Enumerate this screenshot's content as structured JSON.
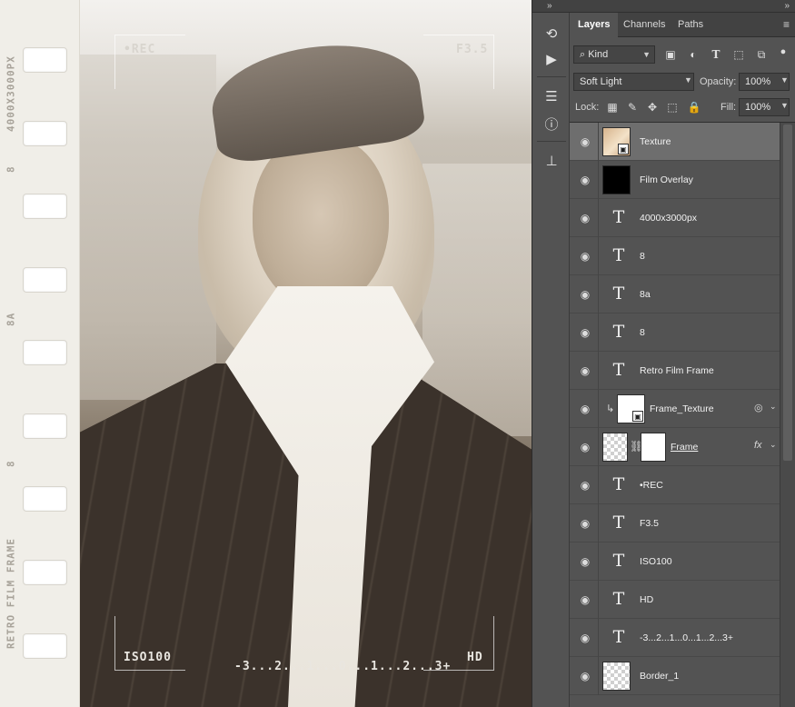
{
  "canvas": {
    "strip_labels": [
      "4000X3000PX",
      "8",
      "8A",
      "8",
      "RETRO FILM FRAME"
    ],
    "overlay": {
      "top_left": "•REC",
      "top_right": "F3.5",
      "bottom_left": "ISO100",
      "bottom_center": "-3...2...1...0...1...2...3+",
      "bottom_right": "HD"
    }
  },
  "dock": {
    "icons": [
      "history-icon",
      "play-action-icon",
      "adjustments-icon",
      "info-icon",
      "stamp-icon"
    ]
  },
  "panel": {
    "tabs": [
      "Layers",
      "Channels",
      "Paths"
    ],
    "active_tab": "Layers",
    "filter_kind": "Kind",
    "blend_mode": "Soft Light",
    "opacity_label": "Opacity:",
    "opacity_value": "100%",
    "lock_label": "Lock:",
    "fill_label": "Fill:",
    "fill_value": "100%"
  },
  "layers": [
    {
      "name": "Texture",
      "kind": "smart-photo",
      "selected": true
    },
    {
      "name": "Film Overlay",
      "kind": "black"
    },
    {
      "name": "4000x3000px",
      "kind": "text"
    },
    {
      "name": "8",
      "kind": "text"
    },
    {
      "name": "8a",
      "kind": "text"
    },
    {
      "name": "8",
      "kind": "text"
    },
    {
      "name": "Retro Film Frame",
      "kind": "text"
    },
    {
      "name": "Frame_Texture",
      "kind": "smart-clipped"
    },
    {
      "name": "Frame",
      "kind": "masked-fx"
    },
    {
      "name": "•REC",
      "kind": "text"
    },
    {
      "name": "F3.5",
      "kind": "text"
    },
    {
      "name": "ISO100",
      "kind": "text"
    },
    {
      "name": "HD",
      "kind": "text"
    },
    {
      "name": "-3...2...1...0...1...2...3+",
      "kind": "text"
    },
    {
      "name": "Border_1",
      "kind": "checker"
    }
  ]
}
